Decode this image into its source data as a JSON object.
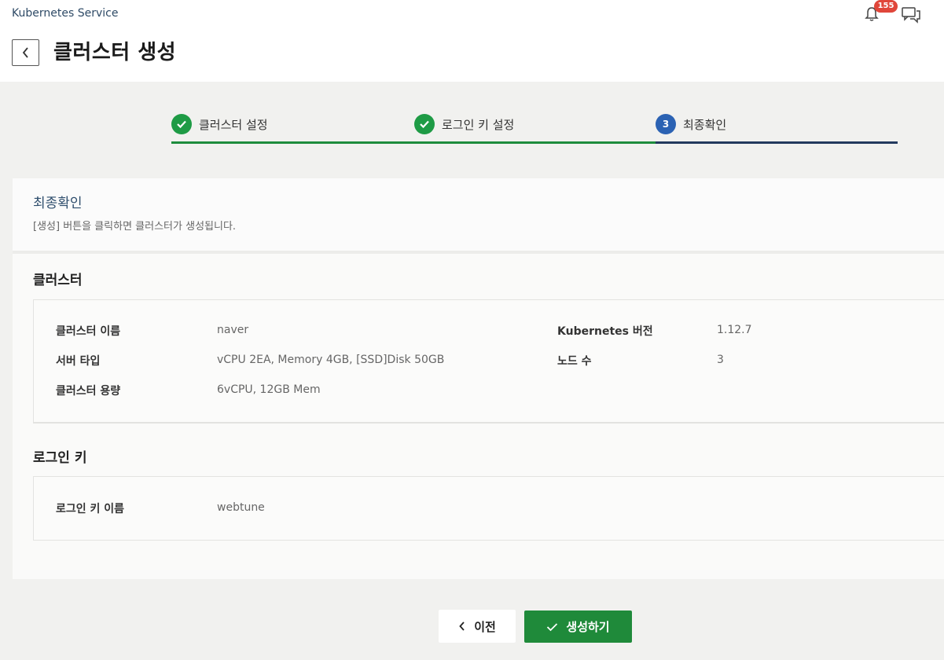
{
  "header": {
    "service_name": "Kubernetes Service",
    "page_title": "클러스터 생성",
    "notification_count": "155"
  },
  "stepper": {
    "steps": [
      {
        "label": "클러스터 설정",
        "status": "done"
      },
      {
        "label": "로그인 키 설정",
        "status": "done"
      },
      {
        "label": "최종확인",
        "status": "active",
        "number": "3"
      }
    ],
    "colors": {
      "done": "#1e9b45",
      "active": "#2b62b3"
    }
  },
  "review": {
    "title": "최종확인",
    "description": "[생성] 버튼을 클릭하면 클러스터가 생성됩니다."
  },
  "cluster_section": {
    "title": "클러스터",
    "fields": [
      {
        "label": "클러스터 이름",
        "value": "naver"
      },
      {
        "label": "서버 타입",
        "value": "vCPU 2EA, Memory 4GB, [SSD]Disk 50GB"
      },
      {
        "label": "클러스터 용량",
        "value": "6vCPU, 12GB Mem"
      },
      {
        "label": "Kubernetes 버전",
        "value": "1.12.7"
      },
      {
        "label": "노드 수",
        "value": "3"
      }
    ]
  },
  "login_key_section": {
    "title": "로그인 키",
    "fields": [
      {
        "label": "로그인 키 이름",
        "value": "webtune"
      }
    ]
  },
  "actions": {
    "prev_label": "이전",
    "create_label": "생성하기"
  },
  "icons": {
    "back": "chevron-left-icon",
    "bell": "bell-icon",
    "chat": "chat-icon",
    "check": "check-icon"
  },
  "brand_colors": {
    "primary_green": "#1f8a3a",
    "navy": "#233a5e"
  }
}
